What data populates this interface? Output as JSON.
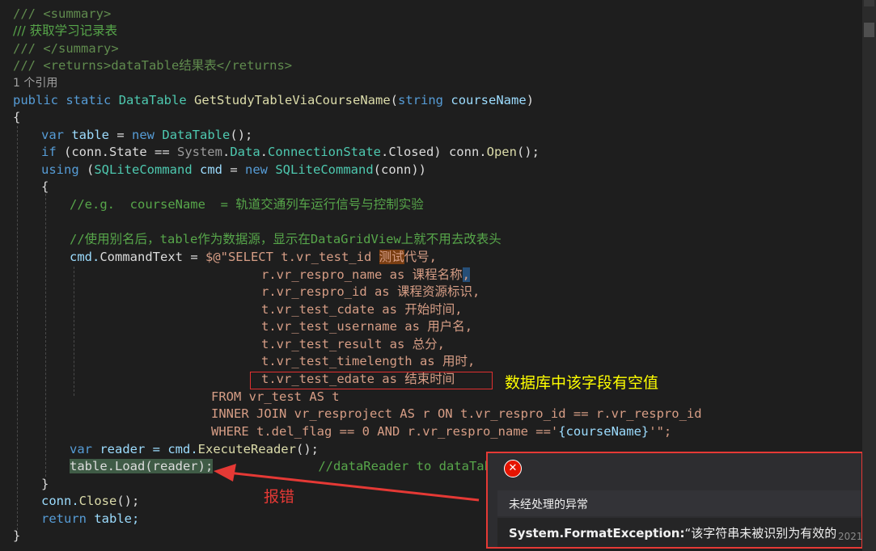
{
  "code": {
    "summary_open": "/// <summary>",
    "summary_text": "/// 获取学习记录表",
    "summary_close": "/// </summary>",
    "returns": "/// <returns>dataTable结果表</returns>",
    "references": "1 个引用",
    "l_public": "public",
    "l_static": "static",
    "l_datatable": "DataTable",
    "l_method": "GetStudyTableViaCourseName",
    "l_paren": "(",
    "l_string": "string",
    "l_param": "courseName",
    "l_close": ")",
    "brace_open": "{",
    "var_table": "var",
    "table_name": "table",
    "eq_new": " = ",
    "new_kw": "new",
    "datatable2": "DataTable",
    "tail1": "();",
    "if_kw": "if",
    "if_rest_a": " (conn.State == ",
    "system": "System",
    "dot": ".",
    "data": "Data",
    "connstate": "ConnectionState",
    "closed_rest": ".Closed) conn.",
    "open": "Open",
    "tail2": "();",
    "using_kw": "using",
    "using_a": " (",
    "sqlcmd": "SQLiteCommand",
    "cmd": " cmd",
    "eq2": " = ",
    "new2": "new",
    "sqlcmd2": "SQLiteCommand",
    "conn_rest": "(conn))",
    "brace2": "{",
    "comment_eg": "//e.g.  courseName  = 轨道交通列车运行信号与控制实验",
    "comment_alias": "//使用别名后，table作为数据源，显示在DataGridView上就不用去改表头",
    "ct_cmd": "cmd.",
    "ct_prop": "CommandText",
    "ct_eq": " = ",
    "sql1_a": "$@\"SELECT t.vr_test_id ",
    "sql1_hl": "测试",
    "sql1_b": "代号,",
    "sql2_a": "r.vr_respro_name as 课程名称",
    "sql2_b": ",",
    "sql3": "r.vr_respro_id as 课程资源标识,",
    "sql4": "t.vr_test_cdate as 开始时间,",
    "sql5": "t.vr_test_username as 用户名,",
    "sql6": "t.vr_test_result as 总分,",
    "sql7": "t.vr_test_timelength as 用时,",
    "sql8": "t.vr_test_edate as 结束时间",
    "sql9": "FROM vr_test AS t",
    "sql10": "INNER JOIN vr_resproject AS r ON t.vr_respro_id == r.vr_respro_id",
    "sql11_a": "WHERE t.del_flag == 0 AND r.vr_respro_name =='",
    "sql11_b": "{courseName}",
    "sql11_c": "'\";",
    "rd_var": "var",
    "rd_a": " reader = cmd.",
    "rd_m": "ExecuteReader",
    "rd_b": "();",
    "load_code": "table.Load(reader);",
    "load_comment": "//dataReader to dataTable",
    "brace3": "}",
    "close_a": "conn.",
    "close_m": "Close",
    "close_b": "();",
    "ret_kw": "return",
    "ret_rest": " table;",
    "brace4": "}"
  },
  "annotations": {
    "null_value_note": "数据库中该字段有空值",
    "error_note": "报错"
  },
  "exception_popup": {
    "title": "未经处理的异常",
    "exception_type": "System.FormatException:",
    "message": "“该字符串未被识别为有效的",
    "icon": "error-x-icon"
  },
  "watermark": "2021",
  "colors": {
    "keyword": "#569cd6",
    "type": "#4ec9b0",
    "comment": "#57a64a",
    "string": "#d69d85",
    "annotation_yellow": "#ffff00",
    "annotation_red": "#e53935"
  }
}
